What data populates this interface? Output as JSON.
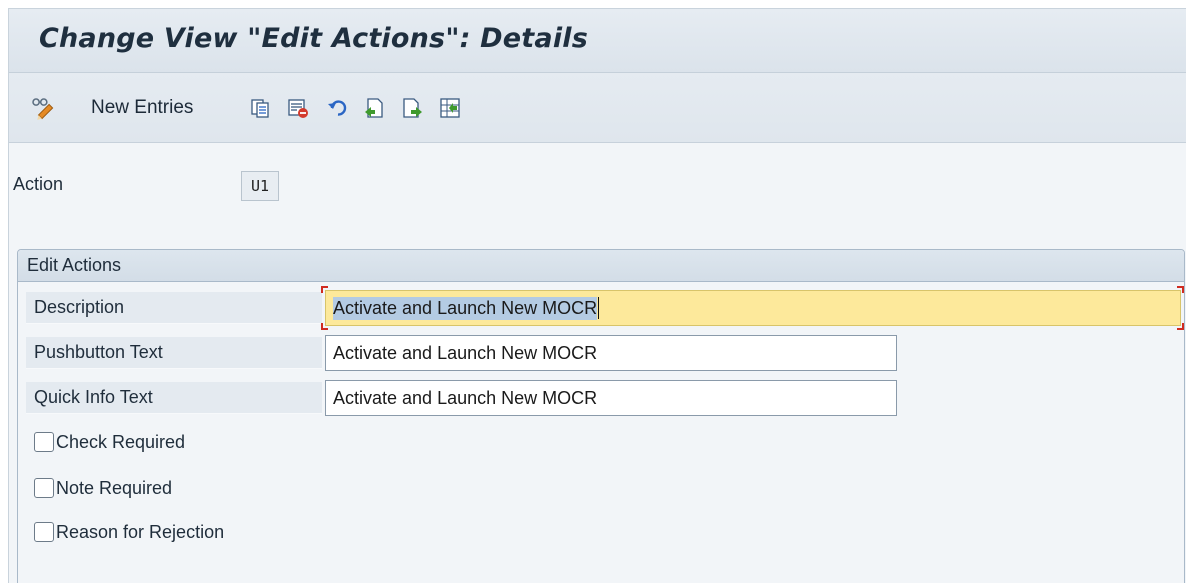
{
  "window": {
    "title": "Change View \"Edit Actions\": Details"
  },
  "toolbar": {
    "items": [
      {
        "icon": "glasses-pencil-icon",
        "label": ""
      },
      {
        "icon": "",
        "label": "New Entries"
      },
      {
        "icon": "copy-icon",
        "label": ""
      },
      {
        "icon": "delete-icon",
        "label": ""
      },
      {
        "icon": "undo-icon",
        "label": ""
      },
      {
        "icon": "previous-entry-icon",
        "label": ""
      },
      {
        "icon": "next-entry-icon",
        "label": ""
      },
      {
        "icon": "select-all-icon",
        "label": ""
      }
    ]
  },
  "header": {
    "action_label": "Action",
    "action_value": "U1"
  },
  "edit_actions": {
    "group_title": "Edit Actions",
    "description": {
      "label": "Description",
      "value": "Activate and Launch New MOCR"
    },
    "pushbutton_text": {
      "label": "Pushbutton Text",
      "value": "Activate and Launch New MOCR"
    },
    "quick_info_text": {
      "label": "Quick Info Text",
      "value": "Activate and Launch New MOCR"
    },
    "checkboxes": [
      {
        "label": "Check Required",
        "checked": false
      },
      {
        "label": "Note Required",
        "checked": false
      },
      {
        "label": "Reason for Rejection",
        "checked": false
      }
    ]
  },
  "colors": {
    "title_bar": "#dbe3eb",
    "focused_field": "#fde99b",
    "selection": "#b4cbe3",
    "focus_corners": "#d02b20",
    "icon_blue": "#2b66c4",
    "icon_green": "#3f9a2d",
    "icon_red": "#d33a2c",
    "icon_orange": "#e58a25"
  }
}
